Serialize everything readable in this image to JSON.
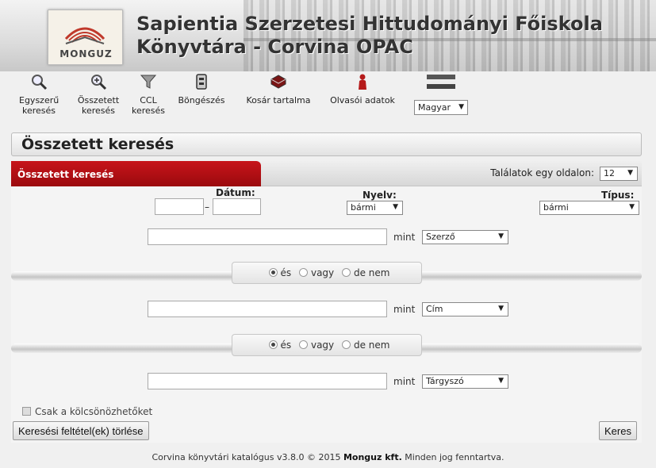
{
  "header": {
    "logo_text": "MONGUZ",
    "title_line1": "Sapientia Szerzetesi Hittudományi Főiskola",
    "title_line2": "Könyvtára - Corvina OPAC"
  },
  "toolbar": {
    "items": [
      {
        "label1": "Egyszerű",
        "label2": "keresés",
        "icon": "magnifier-icon"
      },
      {
        "label1": "Összetett",
        "label2": "keresés",
        "icon": "zoom-plus-icon"
      },
      {
        "label1": "CCL",
        "label2": "keresés",
        "icon": "funnel-icon"
      },
      {
        "label1": "Böngészés",
        "label2": "",
        "icon": "catalog-drawer-icon"
      },
      {
        "label1": "Kosár tartalma",
        "label2": "",
        "icon": "basket-icon"
      },
      {
        "label1": "Olvasói adatok",
        "label2": "",
        "icon": "reader-icon"
      }
    ],
    "language": "Magyar",
    "flag_icon": "hungarian-flag-icon"
  },
  "page_title": "Összetett keresés",
  "panel": {
    "tab_label": "Összetett keresés",
    "per_page_label": "Találatok egy oldalon:",
    "per_page_value": "12",
    "date_label": "Dátum:",
    "date_from": "",
    "date_to": "",
    "language_label": "Nyelv:",
    "language_value": "bármi",
    "type_label": "Típus:",
    "type_value": "bármi",
    "rows": [
      {
        "value": "",
        "mint": "mint",
        "field": "Szerző"
      },
      {
        "value": "",
        "mint": "mint",
        "field": "Cím"
      },
      {
        "value": "",
        "mint": "mint",
        "field": "Tárgyszó"
      }
    ],
    "operators": {
      "and": "és",
      "or": "vagy",
      "not": "de nem"
    },
    "loanable_label": "Csak a kölcsönözhetőket",
    "clear_button": "Keresési feltétel(ek) törlése",
    "search_button": "Keres"
  },
  "footer": {
    "text_before": "Corvina könyvtári katalógus v3.8.0 © 2015",
    "company": "Monguz kft.",
    "text_after": "Minden jog fenntartva."
  },
  "colors": {
    "accent_red": "#b50f14"
  }
}
